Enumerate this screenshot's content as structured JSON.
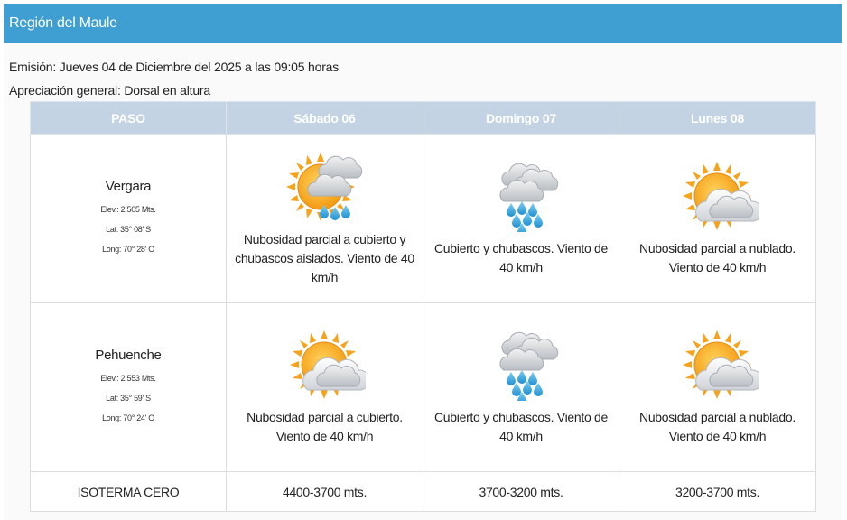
{
  "header": {
    "title": "Región del Maule"
  },
  "emision": "Emisión: Jueves 04 de Diciembre del 2025 a las 09:05 horas",
  "apreciacion": "Apreciación general: Dorsal en altura",
  "table": {
    "headers": [
      "PASO",
      "Sábado 06",
      "Domingo 07",
      "Lunes 08"
    ],
    "passes": [
      {
        "name": "Vergara",
        "elev": "Elev.: 2.505 Mts.",
        "lat": "Lat: 35° 08' S",
        "long": "Long: 70° 28' O",
        "forecast": [
          {
            "icon": "sun-cloud-rain-icon",
            "text": "Nubosidad parcial a cubierto y chubascos aislados. Viento de 40 km/h"
          },
          {
            "icon": "cloud-rain-icon",
            "text": "Cubierto y chubascos. Viento de 40 km/h"
          },
          {
            "icon": "sun-cloud-icon",
            "text": "Nubosidad parcial a nublado. Viento de 40 km/h"
          }
        ]
      },
      {
        "name": "Pehuenche",
        "elev": "Elev.: 2.553 Mts.",
        "lat": "Lat: 35° 59' S",
        "long": "Long: 70° 24' O",
        "forecast": [
          {
            "icon": "sun-cloud-icon",
            "text": "Nubosidad parcial a cubierto. Viento de 40 km/h"
          },
          {
            "icon": "cloud-rain-icon",
            "text": "Cubierto y chubascos. Viento de 40 km/h"
          },
          {
            "icon": "sun-cloud-icon",
            "text": "Nubosidad parcial a nublado. Viento de 40 km/h"
          }
        ]
      }
    ],
    "isoterma": {
      "label": "ISOTERMA CERO",
      "values": [
        "4400-3700 mts.",
        "3700-3200 mts.",
        "3200-3700 mts."
      ]
    }
  },
  "colors": {
    "header": "#3f9ed2",
    "table_header": "#c3d3e4",
    "sun": "#f6a21a",
    "rain": "#3fa8e0"
  }
}
